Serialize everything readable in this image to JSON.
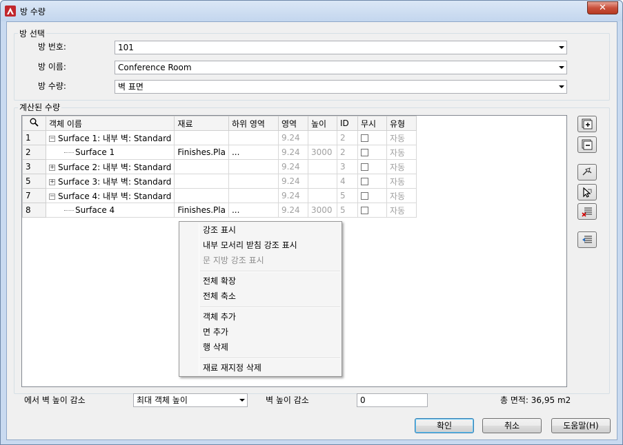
{
  "window": {
    "title": "방 수량",
    "close_label": "✕"
  },
  "room_selection": {
    "group_label": "방 선택",
    "room_number_label": "방 번호:",
    "room_number_value": "101",
    "room_name_label": "방 이름:",
    "room_name_value": "Conference Room",
    "room_quantity_label": "방 수량:",
    "room_quantity_value": "벽 표면"
  },
  "computed": {
    "group_label": "계산된 수량",
    "columns": [
      "객체 이름",
      "재료",
      "하위 영역",
      "영역",
      "높이",
      "ID",
      "무시",
      "유형"
    ],
    "rows": [
      {
        "num": "1",
        "toggle": "−",
        "name": "Surface 1: 내부 벽: Standard",
        "material": "",
        "sub": "",
        "area": "9.24",
        "height": "",
        "id": "2",
        "type": "자동",
        "child": false
      },
      {
        "num": "2",
        "toggle": "",
        "name": "Surface 1",
        "material": "Finishes.Pla",
        "sub": "...",
        "area": "9.24",
        "height": "3000",
        "id": "2",
        "type": "자동",
        "child": true
      },
      {
        "num": "3",
        "toggle": "+",
        "name": "Surface 2: 내부 벽: Standard",
        "material": "",
        "sub": "",
        "area": "9.24",
        "height": "",
        "id": "3",
        "type": "자동",
        "child": false
      },
      {
        "num": "5",
        "toggle": "+",
        "name": "Surface 3: 내부 벽: Standard",
        "material": "",
        "sub": "",
        "area": "9.24",
        "height": "",
        "id": "4",
        "type": "자동",
        "child": false
      },
      {
        "num": "7",
        "toggle": "−",
        "name": "Surface 4: 내부 벽: Standard",
        "material": "",
        "sub": "",
        "area": "9.24",
        "height": "",
        "id": "5",
        "type": "자동",
        "child": false
      },
      {
        "num": "8",
        "toggle": "",
        "name": "Surface 4",
        "material": "Finishes.Pla",
        "sub": "...",
        "area": "9.24",
        "height": "3000",
        "id": "5",
        "type": "자동",
        "child": true
      }
    ]
  },
  "context_menu": {
    "items": [
      {
        "label": "강조 표시",
        "enabled": true
      },
      {
        "label": "내부 모서리 받침 강조 표시",
        "enabled": true
      },
      {
        "label": "문 지방 강조 표시",
        "enabled": false
      },
      {
        "label": "전체 확장",
        "enabled": true
      },
      {
        "label": "전체 축소",
        "enabled": true
      },
      {
        "label": "객체 추가",
        "enabled": true
      },
      {
        "label": "면 추가",
        "enabled": true
      },
      {
        "label": "행 삭제",
        "enabled": true
      },
      {
        "label": "재료 재지정 삭제",
        "enabled": true
      }
    ]
  },
  "footer": {
    "reduce_label": "에서 벽 높이 감소",
    "reduce_option": "최대 객체 높이",
    "wall_height_label": "벽 높이 감소",
    "wall_height_value": "0",
    "total_area": "총 면적: 36,95 m2",
    "ok_label": "확인",
    "cancel_label": "취소",
    "help_label": "도움말(H)"
  },
  "icons": {
    "app": "autocad-logo-icon",
    "search": "magnifier-icon",
    "side": [
      "expand-all-icon",
      "collapse-all-icon",
      "add-object-icon",
      "add-face-icon",
      "delete-row-icon",
      "material-override-icon"
    ]
  },
  "colors": {
    "accent": "#c9503b",
    "dim_text": "#a0a0a0"
  }
}
